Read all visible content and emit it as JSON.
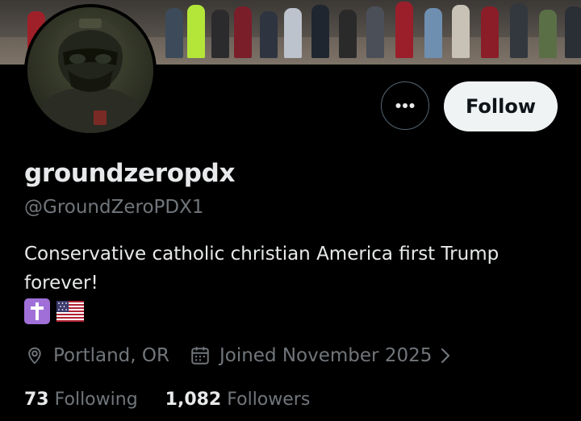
{
  "profile": {
    "display_name": "groundzeropdx",
    "handle": "@GroundZeroPDX1",
    "bio": "Conservative catholic christian America first Trump forever!",
    "bio_emojis": [
      "latin-cross-emoji",
      "us-flag-emoji"
    ]
  },
  "actions": {
    "more_icon": "more-dots-icon",
    "follow_label": "Follow"
  },
  "meta": {
    "location": "Portland, OR",
    "location_icon": "location-pin-icon",
    "joined": "Joined November 2025",
    "joined_icon": "calendar-icon",
    "chevron_icon": "chevron-right-icon"
  },
  "counts": {
    "following_num": "73",
    "following_label": "Following",
    "followers_num": "1,082",
    "followers_label": "Followers"
  },
  "colors": {
    "background": "#000000",
    "primary_text": "#e7e9ea",
    "secondary_text": "#71767b",
    "follow_button_bg": "#eff3f4",
    "follow_button_text": "#0f1419",
    "border": "#536471"
  }
}
